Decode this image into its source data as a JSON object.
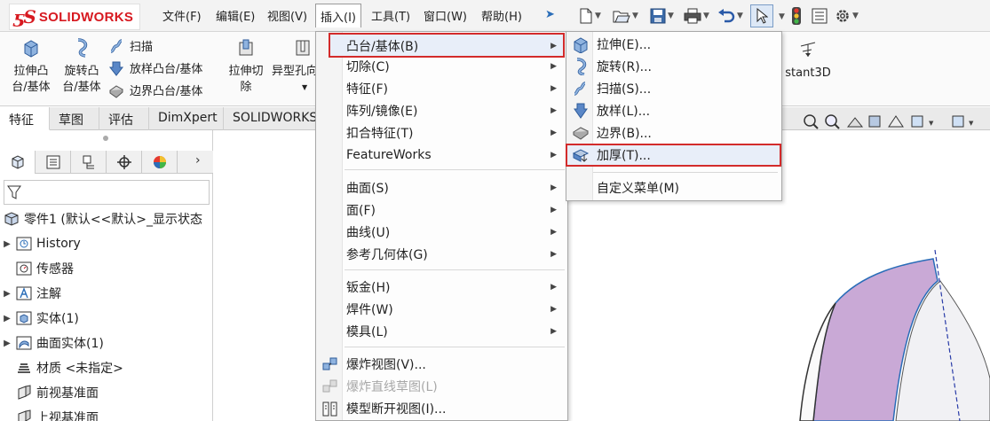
{
  "app": {
    "logo_text": "SOLIDWORKS"
  },
  "menubar": {
    "items": [
      "文件(F)",
      "编辑(E)",
      "视图(V)",
      "插入(I)",
      "工具(T)",
      "窗口(W)",
      "帮助(H)"
    ]
  },
  "ribbon": {
    "extrude_boss": [
      "拉伸凸",
      "台/基体"
    ],
    "revolve_boss": [
      "旋转凸",
      "台/基体"
    ],
    "sweep": "扫描",
    "loft": "放样凸台/基体",
    "boundary": "边界凸台/基体",
    "extrude_cut": [
      "拉伸切",
      "除"
    ],
    "hole_wizard": "异型孔向",
    "instant3d": "stant3D"
  },
  "tabs": [
    "特征",
    "草图",
    "评估",
    "DimXpert",
    "SOLIDWORKS"
  ],
  "tree": {
    "root": "零件1  (默认<<默认>_显示状态",
    "items": [
      {
        "label": "History",
        "expandable": true
      },
      {
        "label": "传感器",
        "expandable": false
      },
      {
        "label": "注解",
        "expandable": true
      },
      {
        "label": "实体(1)",
        "expandable": true
      },
      {
        "label": "曲面实体(1)",
        "expandable": true
      },
      {
        "label": "材质 <未指定>",
        "expandable": false
      },
      {
        "label": "前视基准面",
        "expandable": false
      },
      {
        "label": "上视基准面",
        "expandable": false
      }
    ]
  },
  "insert_menu": {
    "items": [
      {
        "label": "凸台/基体(B)",
        "submenu": true
      },
      {
        "label": "切除(C)",
        "submenu": true
      },
      {
        "label": "特征(F)",
        "submenu": true
      },
      {
        "label": "阵列/镜像(E)",
        "submenu": true
      },
      {
        "label": "扣合特征(T)",
        "submenu": true
      },
      {
        "label": "FeatureWorks",
        "submenu": true
      },
      {
        "label": "曲面(S)",
        "submenu": true
      },
      {
        "label": "面(F)",
        "submenu": true
      },
      {
        "label": "曲线(U)",
        "submenu": true
      },
      {
        "label": "参考几何体(G)",
        "submenu": true
      },
      {
        "label": "钣金(H)",
        "submenu": true
      },
      {
        "label": "焊件(W)",
        "submenu": true
      },
      {
        "label": "模具(L)",
        "submenu": true
      },
      {
        "label": "爆炸视图(V)...",
        "submenu": false
      },
      {
        "label": "爆炸直线草图(L)",
        "submenu": false,
        "disabled": true
      },
      {
        "label": "模型断开视图(I)...",
        "submenu": false
      }
    ]
  },
  "boss_submenu": {
    "items": [
      "拉伸(E)...",
      "旋转(R)...",
      "扫描(S)...",
      "放样(L)...",
      "边界(B)...",
      "加厚(T)...",
      "自定义菜单(M)"
    ]
  },
  "colors": {
    "highlight_border": "#d32b2b",
    "brand": "#d71920",
    "surface": "#c9a9d6"
  }
}
